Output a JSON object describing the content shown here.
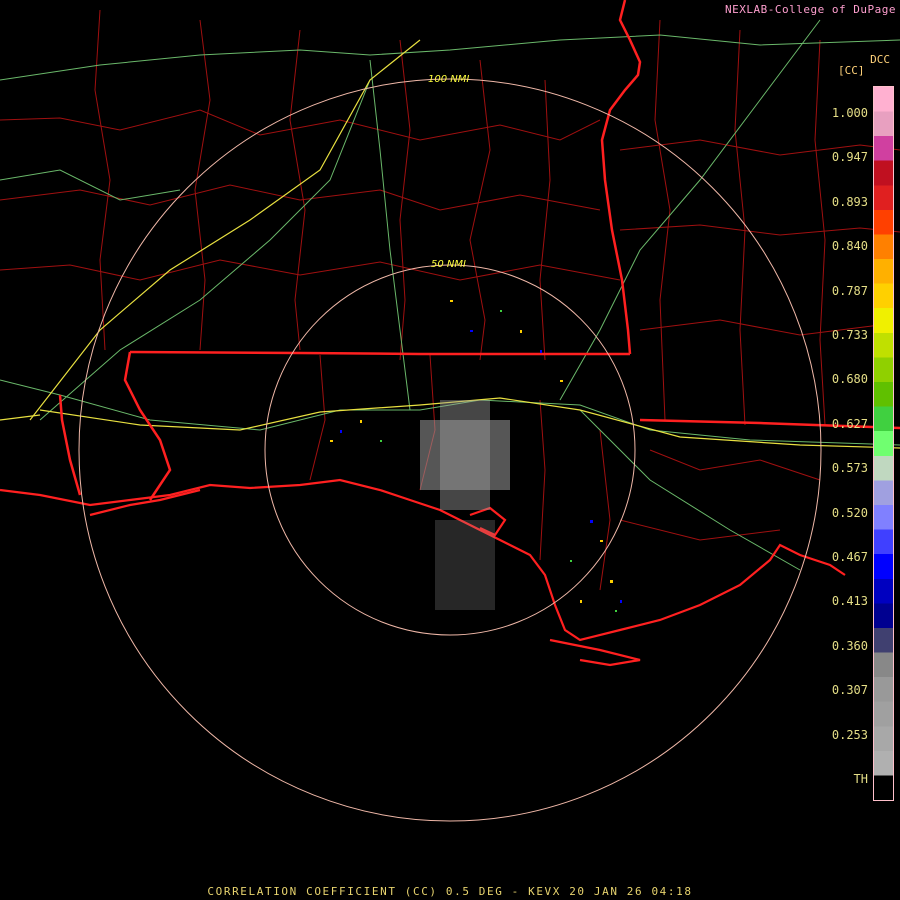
{
  "header": {
    "credit": "NEXLAB-College of DuPage",
    "site": "DCC",
    "unit": "[CC]"
  },
  "range_rings": [
    {
      "label": "100 NMI",
      "range_nmi": 100
    },
    {
      "label": "50 NMI",
      "range_nmi": 50
    }
  ],
  "legend": {
    "labels": [
      "1.000",
      "0.947",
      "0.893",
      "0.840",
      "0.787",
      "0.733",
      "0.680",
      "0.627",
      "0.573",
      "0.520",
      "0.467",
      "0.413",
      "0.360",
      "0.307",
      "0.253",
      "TH"
    ],
    "colors": [
      "#ffb0d0",
      "#e8a0c0",
      "#d040a0",
      "#c01020",
      "#e02020",
      "#ff4000",
      "#ff8000",
      "#ffb000",
      "#ffd000",
      "#f0f000",
      "#c0e000",
      "#90d000",
      "#60c000",
      "#40d040",
      "#70ff70",
      "#c0d8c0",
      "#a0a0e0",
      "#8080ff",
      "#4040ff",
      "#0000ff",
      "#0000c0",
      "#000090",
      "#404070",
      "#888888",
      "#999999",
      "#a0a0a0",
      "#a8a8a8",
      "#b0b0b0",
      "#000000"
    ],
    "accent": "#ffc0cb"
  },
  "footer": "CORRELATION COEFFICIENT (CC) 0.5 DEG - KEVX 20 JAN 26 04:18"
}
